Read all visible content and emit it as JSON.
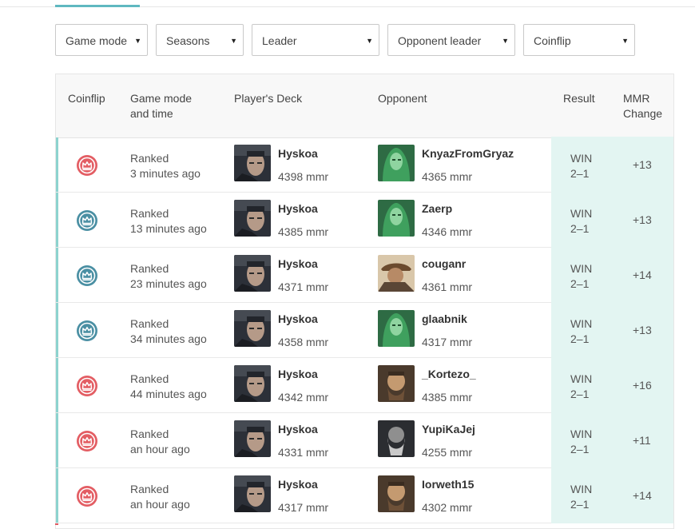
{
  "filters": [
    {
      "label": "Game mode"
    },
    {
      "label": "Seasons"
    },
    {
      "label": "Leader"
    },
    {
      "label": "Opponent leader"
    },
    {
      "label": "Coinflip"
    }
  ],
  "headers": {
    "coinflip": "Coinflip",
    "mode_line1": "Game mode",
    "mode_line2": "and time",
    "deck": "Player's Deck",
    "opponent": "Opponent",
    "result": "Result",
    "mmr_line1": "MMR",
    "mmr_line2": "Change"
  },
  "colors": {
    "coin_red": "#e35d63",
    "coin_blue": "#4a8fa3",
    "accent": "#8dd3cf",
    "result_bg": "#e3f5f2"
  },
  "matches": [
    {
      "coin": "red",
      "mode": "Ranked",
      "time": "3 minutes ago",
      "player": "Hyskoa",
      "player_mmr": "4398 mmr",
      "opponent": "KnyazFromGryaz",
      "opponent_mmr": "4365 mmr",
      "opp_avatar": "green",
      "result": "WIN",
      "score": "2–1",
      "change": "+13"
    },
    {
      "coin": "blue",
      "mode": "Ranked",
      "time": "13 minutes ago",
      "player": "Hyskoa",
      "player_mmr": "4385 mmr",
      "opponent": "Zaerp",
      "opponent_mmr": "4346 mmr",
      "opp_avatar": "green",
      "result": "WIN",
      "score": "2–1",
      "change": "+13"
    },
    {
      "coin": "blue",
      "mode": "Ranked",
      "time": "23 minutes ago",
      "player": "Hyskoa",
      "player_mmr": "4371 mmr",
      "opponent": "couganr",
      "opponent_mmr": "4361 mmr",
      "opp_avatar": "brown",
      "result": "WIN",
      "score": "2–1",
      "change": "+14"
    },
    {
      "coin": "blue",
      "mode": "Ranked",
      "time": "34 minutes ago",
      "player": "Hyskoa",
      "player_mmr": "4358 mmr",
      "opponent": "glaabnik",
      "opponent_mmr": "4317 mmr",
      "opp_avatar": "green",
      "result": "WIN",
      "score": "2–1",
      "change": "+13"
    },
    {
      "coin": "red",
      "mode": "Ranked",
      "time": "44 minutes ago",
      "player": "Hyskoa",
      "player_mmr": "4342 mmr",
      "opponent": "_Kortezo_",
      "opponent_mmr": "4385 mmr",
      "opp_avatar": "tan",
      "result": "WIN",
      "score": "2–1",
      "change": "+16"
    },
    {
      "coin": "red",
      "mode": "Ranked",
      "time": "an hour ago",
      "player": "Hyskoa",
      "player_mmr": "4331 mmr",
      "opponent": "YupiKaJej",
      "opponent_mmr": "4255 mmr",
      "opp_avatar": "gray",
      "result": "WIN",
      "score": "2–1",
      "change": "+11"
    },
    {
      "coin": "red",
      "mode": "Ranked",
      "time": "an hour ago",
      "player": "Hyskoa",
      "player_mmr": "4317 mmr",
      "opponent": "Iorweth15",
      "opponent_mmr": "4302 mmr",
      "opp_avatar": "tan",
      "result": "WIN",
      "score": "2–1",
      "change": "+14"
    }
  ]
}
